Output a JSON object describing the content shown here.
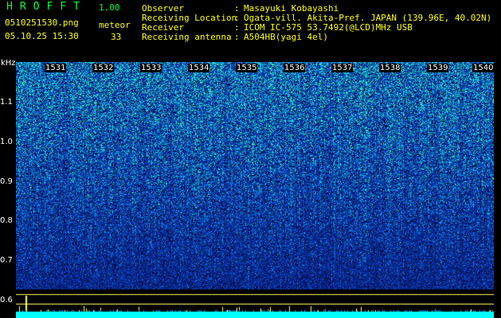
{
  "header": {
    "app_title": "HROFFT",
    "app_version": "1.00",
    "file_name": "0510251530.png",
    "datetime": "05.10.25 15:30",
    "meteor_label": "meteor",
    "meteor_count": "33",
    "info": [
      {
        "label": "Observer",
        "value": "Masayuki Kobayashi"
      },
      {
        "label": "Receiving Location",
        "value": "Ogata-vill. Akita-Pref. JAPAN (139.96E, 40.02N)"
      },
      {
        "label": "Receiver",
        "value": "ICOM IC-575 53.7492(@LCD)MHz USB"
      },
      {
        "label": "Receiving antenna",
        "value": "A504HB(yagi 4el)"
      }
    ],
    "separator": ":"
  },
  "y_axis": {
    "unit": "kHz",
    "ticks": [
      "1.1",
      "1.0",
      "0.9",
      "0.8",
      "0.7",
      "0.6"
    ]
  },
  "x_axis": {
    "ticks": [
      "1531",
      "1532",
      "1533",
      "1534",
      "1535",
      "1536",
      "1537",
      "1538",
      "1539",
      "1540"
    ]
  },
  "colors": {
    "background": "#000000",
    "title_green": "#00ff40",
    "info_yellow": "#ffff00",
    "spectrogram_base": "#0a1f8a",
    "spectrogram_high": "#00c8ff",
    "baseline_cyan": "#00ffff",
    "line_yellow": "#ffff66"
  }
}
